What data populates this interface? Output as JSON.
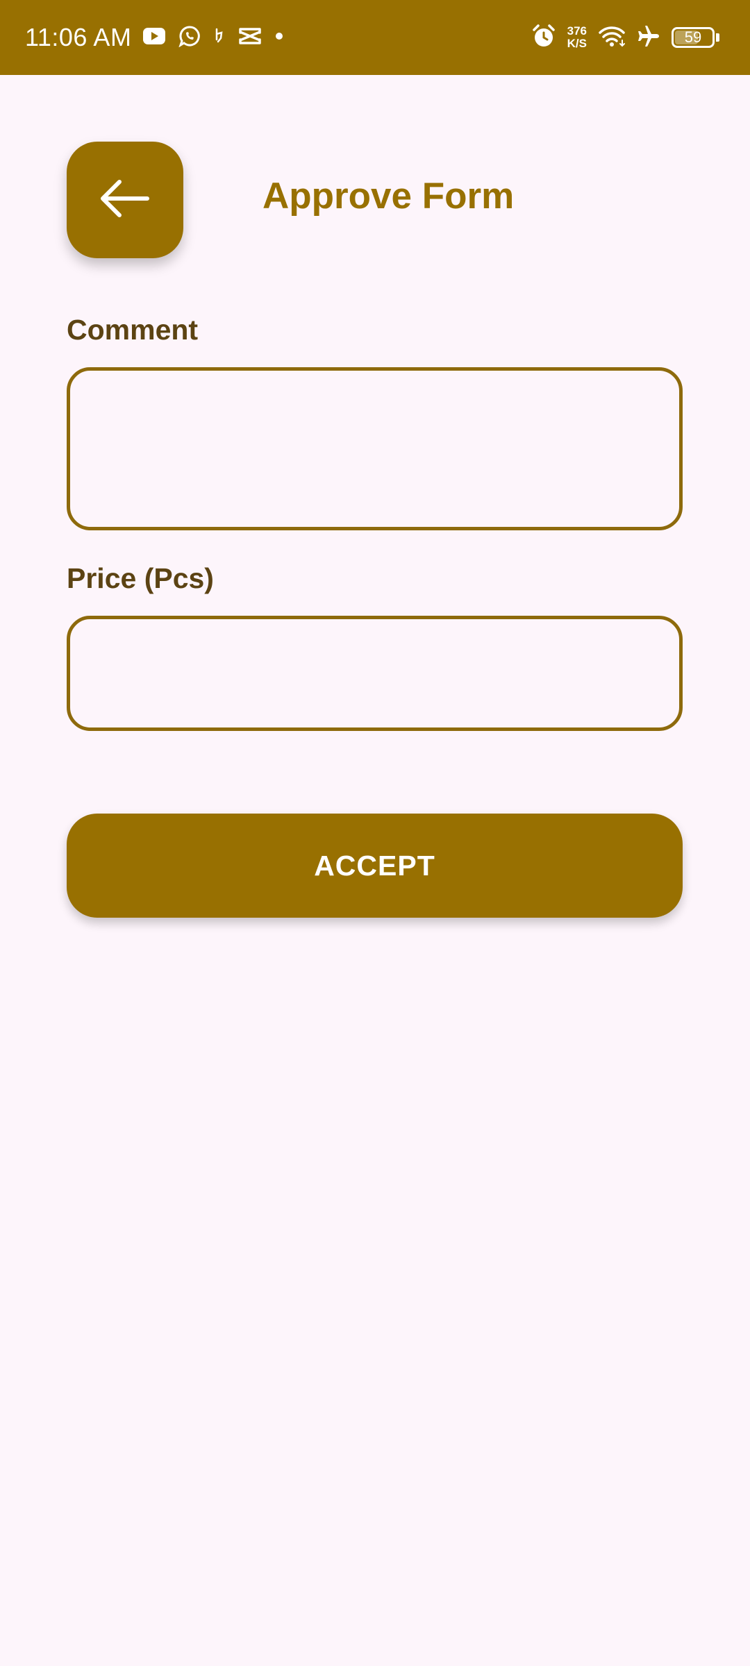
{
  "status_bar": {
    "time": "11:06 AM",
    "net_speed_value": "376",
    "net_speed_unit": "K/S",
    "battery_level": "59",
    "icons_left": [
      "youtube-icon",
      "whatsapp-icon",
      "notification-icon",
      "capcut-icon",
      "more-dot-icon"
    ],
    "icons_right": [
      "alarm-icon",
      "wifi-icon",
      "airplane-mode-icon",
      "battery-icon"
    ]
  },
  "header": {
    "back_icon": "arrow-left-icon",
    "title": "Approve Form"
  },
  "form": {
    "comment_label": "Comment",
    "comment_value": "",
    "price_label": "Price (Pcs)",
    "price_value": ""
  },
  "actions": {
    "accept_label": "ACCEPT"
  },
  "colors": {
    "primary": "#987001",
    "label_text": "#5C4313",
    "field_border": "#8E6A0C",
    "background": "#FDF5FB"
  }
}
